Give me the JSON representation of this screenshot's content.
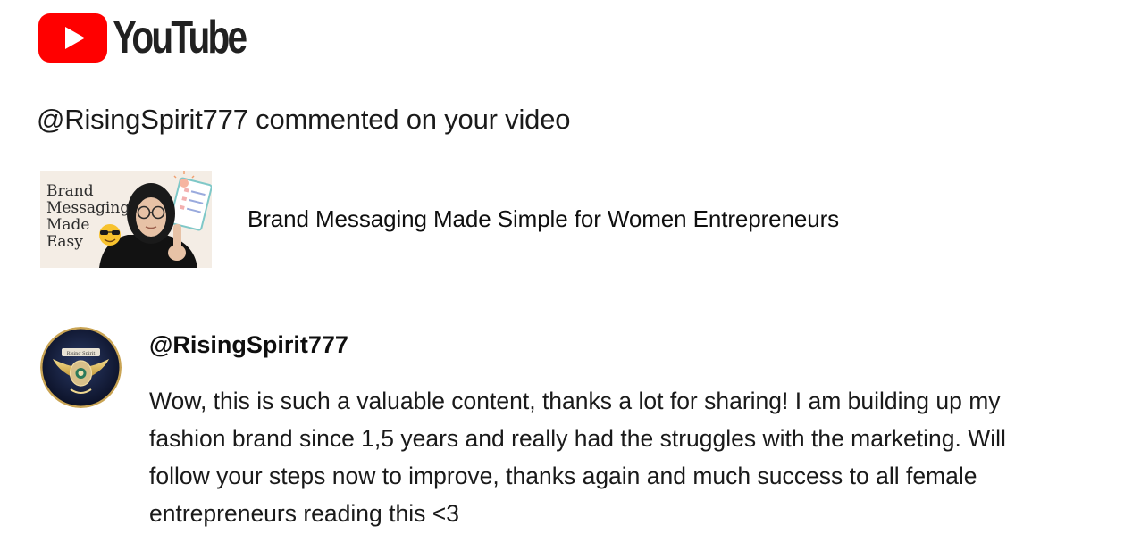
{
  "header": {
    "logo_text": "YouTube",
    "brand_red": "#ff0000",
    "logo_icon": "youtube-play-icon"
  },
  "notification": {
    "headline": "@RisingSpirit777 commented on your video"
  },
  "video": {
    "thumbnail_lines": [
      "Brand",
      "Messaging",
      "Made",
      "Easy"
    ],
    "title": "Brand Messaging Made Simple for Women Entrepreneurs"
  },
  "comment": {
    "author": "@RisingSpirit777",
    "avatar_text": "Rising Spirit",
    "lines": [
      "Wow, this is such a valuable content, thanks a lot for sharing! I am building up my",
      "fashion brand since 1,5 years and really had the struggles with the marketing. Will",
      "follow your steps now to improve, thanks again and much success to all female",
      "entrepreneurs reading this <3"
    ]
  }
}
